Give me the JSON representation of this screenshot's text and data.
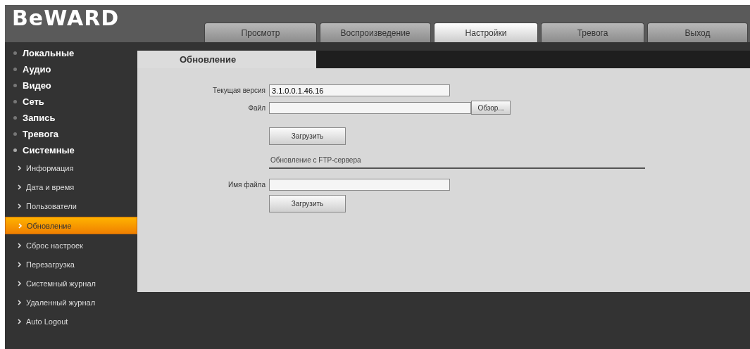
{
  "logo": "BeWARD",
  "nav_tabs": [
    {
      "label": "Просмотр",
      "selected": false
    },
    {
      "label": "Воспроизведение",
      "selected": false
    },
    {
      "label": "Настройки",
      "selected": true
    },
    {
      "label": "Тревога",
      "selected": false
    },
    {
      "label": "Выход",
      "selected": false
    }
  ],
  "sidebar": {
    "items": [
      {
        "label": "Локальные",
        "expanded": false
      },
      {
        "label": "Аудио",
        "expanded": false
      },
      {
        "label": "Видео",
        "expanded": false
      },
      {
        "label": "Сеть",
        "expanded": false
      },
      {
        "label": "Запись",
        "expanded": false
      },
      {
        "label": "Тревога",
        "expanded": false
      },
      {
        "label": "Системные",
        "expanded": true,
        "children": [
          {
            "label": "Информация",
            "selected": false
          },
          {
            "label": "Дата и время",
            "selected": false
          },
          {
            "label": "Пользователи",
            "selected": false
          },
          {
            "label": "Обновление",
            "selected": true
          },
          {
            "label": "Сброс настроек",
            "selected": false
          },
          {
            "label": "Перезагрузка",
            "selected": false
          },
          {
            "label": "Системный журнал",
            "selected": false
          },
          {
            "label": "Удаленный журнал",
            "selected": false
          },
          {
            "label": "Auto Logout",
            "selected": false
          }
        ]
      }
    ]
  },
  "page_tab": {
    "label": "Обновление"
  },
  "form": {
    "current_version": {
      "label": "Текущая версия",
      "value": "3.1.0.0.1.46.16"
    },
    "file": {
      "label": "Файл",
      "browse_button": "Обзор..."
    },
    "upload_button": "Загрузить",
    "ftp_section": {
      "title": "Обновление с FTP-сервера"
    },
    "file_name": {
      "label": "Имя файла"
    },
    "ftp_upload_button": "Загрузить"
  }
}
